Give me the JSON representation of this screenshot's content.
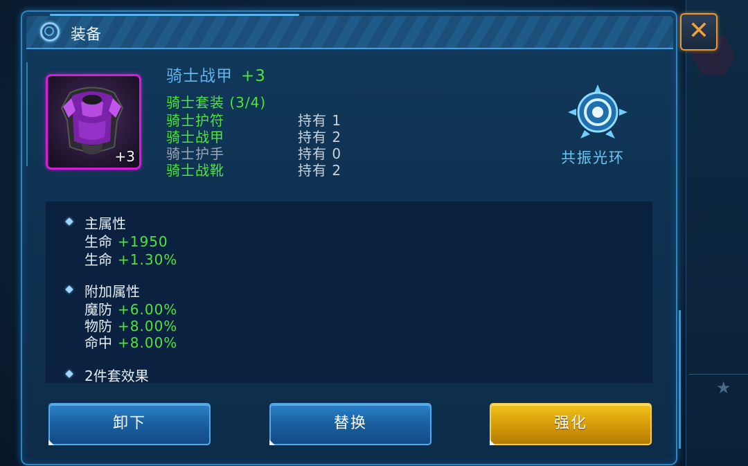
{
  "window": {
    "title": "装备",
    "close_label": "✕"
  },
  "item": {
    "name": "骑士战甲",
    "enhance_level": "+3",
    "slot_level": "+3",
    "rarity_color": "#d21fd6"
  },
  "set": {
    "title": "骑士套装 (3/4)",
    "pieces": [
      {
        "name": "骑士护符",
        "count": "持有 1",
        "owned": true
      },
      {
        "name": "骑士战甲",
        "count": "持有 2",
        "owned": true
      },
      {
        "name": "骑士护手",
        "count": "持有 0",
        "owned": false
      },
      {
        "name": "骑士战靴",
        "count": "持有 2",
        "owned": true
      }
    ]
  },
  "resonance": {
    "label": "共振光环",
    "icon": "resonance-aura-icon"
  },
  "attributes": {
    "main": {
      "title": "主属性",
      "lines": [
        {
          "name": "生命",
          "value": "+1950"
        },
        {
          "name": "生命",
          "value": "+1.30%"
        }
      ]
    },
    "extra": {
      "title": "附加属性",
      "lines": [
        {
          "name": "魔防",
          "value": "+6.00%"
        },
        {
          "name": "物防",
          "value": "+8.00%"
        },
        {
          "name": "命中",
          "value": "+8.00%"
        }
      ]
    },
    "set_effect": {
      "title": "2件套效果"
    }
  },
  "buttons": {
    "unequip": "卸下",
    "replace": "替换",
    "enhance": "强化"
  },
  "colors": {
    "accent_green": "#4fe33c",
    "accent_blue": "#5fb4ee",
    "gold_button": "#e0a80c",
    "close_orange": "#e79a33"
  }
}
